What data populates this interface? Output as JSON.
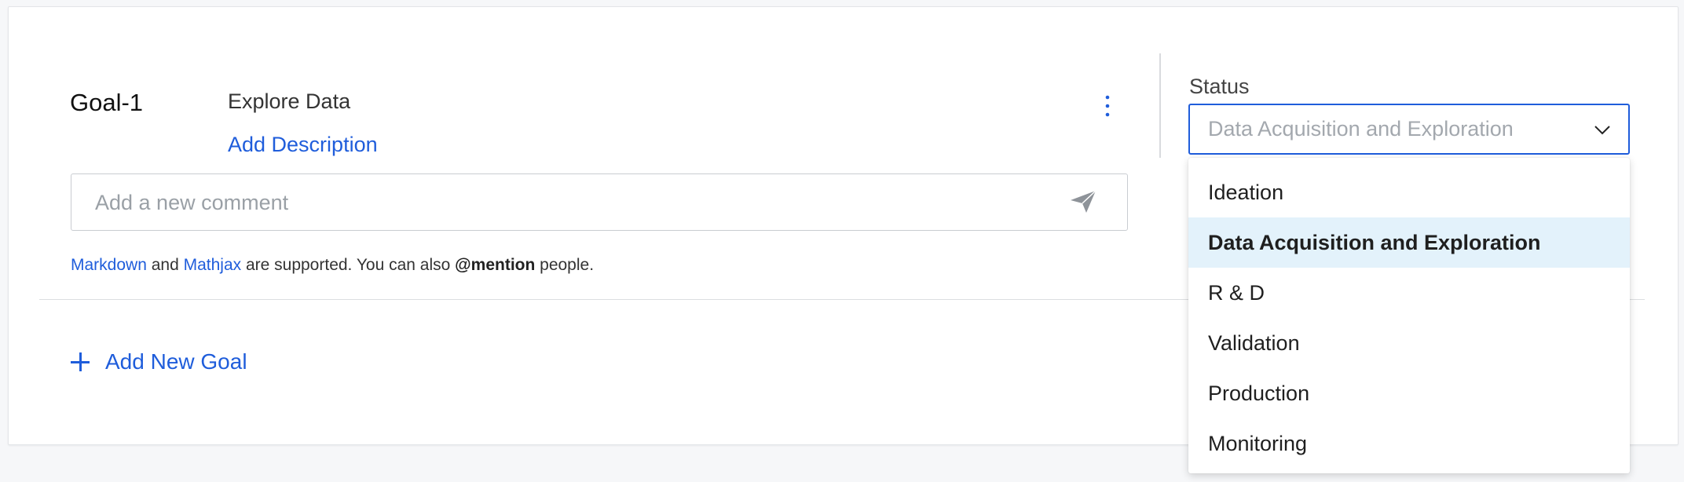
{
  "goal": {
    "label": "Goal-1",
    "title": "Explore Data",
    "add_description": "Add Description"
  },
  "comment": {
    "placeholder": "Add a new comment",
    "helper": {
      "markdown_link": "Markdown",
      "and": " and ",
      "mathjax_link": "Mathjax",
      "middle": " are supported. You can also ",
      "mention": "@mention",
      "end": " people."
    }
  },
  "add_goal_label": "Add New Goal",
  "status": {
    "label": "Status",
    "selected": "Data Acquisition and Exploration",
    "options": [
      "Ideation",
      "Data Acquisition and Exploration",
      "R & D",
      "Validation",
      "Production",
      "Monitoring"
    ],
    "selected_index": 1
  },
  "colors": {
    "accent": "#1f5ddb",
    "selected_bg": "#e3f2fb",
    "placeholder": "#9aa0a6"
  },
  "icons": [
    "kebab-menu-icon",
    "send-icon",
    "plus-icon",
    "chevron-down-icon"
  ]
}
